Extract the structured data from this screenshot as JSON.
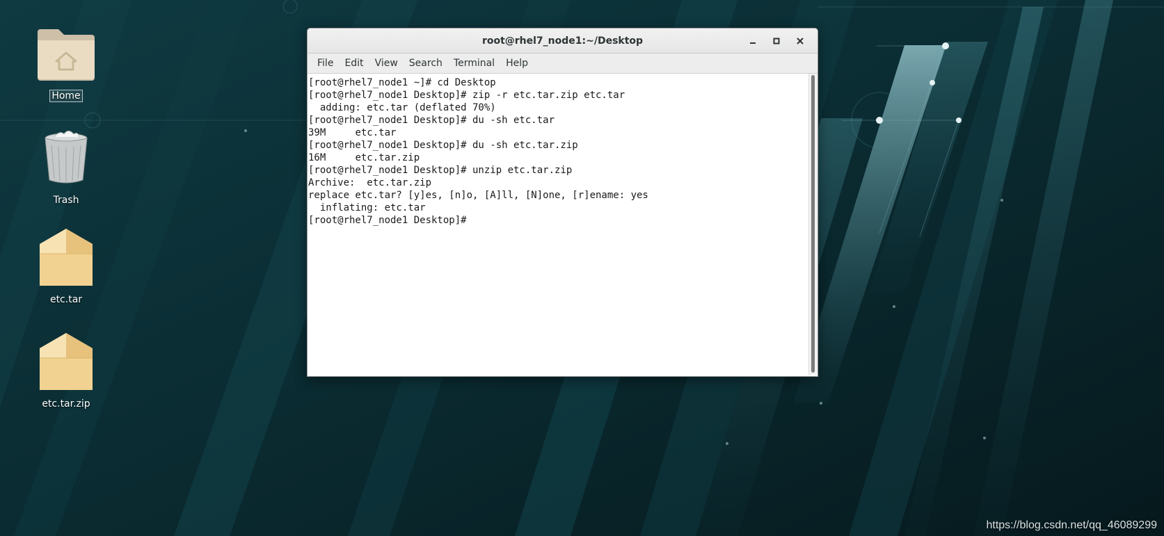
{
  "desktop": {
    "icons": [
      {
        "label": "Home",
        "icon": "home-folder-icon"
      },
      {
        "label": "Trash",
        "icon": "trash-icon"
      },
      {
        "label": "etc.tar",
        "icon": "archive-box-icon"
      },
      {
        "label": "etc.tar.zip",
        "icon": "archive-box-icon"
      }
    ],
    "watermark": "https://blog.csdn.net/qq_46089299"
  },
  "terminal": {
    "title": "root@rhel7_node1:~/Desktop",
    "menu": [
      "File",
      "Edit",
      "View",
      "Search",
      "Terminal",
      "Help"
    ],
    "lines": [
      "[root@rhel7_node1 ~]# cd Desktop",
      "[root@rhel7_node1 Desktop]# zip -r etc.tar.zip etc.tar",
      "  adding: etc.tar (deflated 70%)",
      "[root@rhel7_node1 Desktop]# du -sh etc.tar",
      "39M\tetc.tar",
      "[root@rhel7_node1 Desktop]# du -sh etc.tar.zip",
      "16M\tetc.tar.zip",
      "[root@rhel7_node1 Desktop]# unzip etc.tar.zip",
      "Archive:  etc.tar.zip",
      "replace etc.tar? [y]es, [n]o, [A]ll, [N]one, [r]ename: yes",
      "  inflating: etc.tar",
      "[root@rhel7_node1 Desktop]# "
    ],
    "window_controls": [
      "minimize-icon",
      "maximize-icon",
      "close-icon"
    ]
  },
  "colors": {
    "wallpaper_dark": "#0b2a30",
    "wallpaper_teal": "#1d5a66",
    "terminal_bg": "#ffffff",
    "terminal_fg": "#1a1a1a"
  }
}
